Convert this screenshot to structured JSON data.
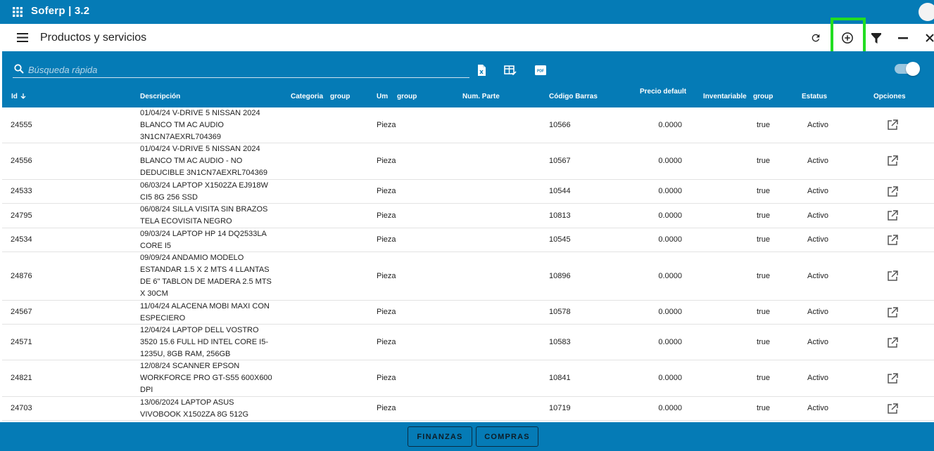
{
  "app": {
    "title": "Soferp | 3.2"
  },
  "header": {
    "title": "Productos y servicios"
  },
  "search": {
    "placeholder": "Búsqueda rápida",
    "value": ""
  },
  "columns": {
    "id": "Id",
    "descripcion": "Descripción",
    "categoria": "Categoria",
    "categoria_group": "group",
    "um": "Um",
    "um_group": "group",
    "num_parte": "Num. Parte",
    "codigo_barras": "Código Barras",
    "precio_default": "Precio default",
    "inventariable": "Inventariable",
    "inventariable_group": "group",
    "estatus": "Estatus",
    "opciones": "Opciones"
  },
  "rows": [
    {
      "id": "24555",
      "desc": [
        "01/04/24 V-DRIVE 5 NISSAN 2024",
        "BLANCO TM AC AUDIO",
        "3N1CN7AEXRL704369"
      ],
      "um": "Pieza",
      "codigo": "10566",
      "precio": "0.0000",
      "inventariable": "true",
      "estatus": "Activo"
    },
    {
      "id": "24556",
      "desc": [
        "01/04/24 V-DRIVE 5 NISSAN 2024",
        "BLANCO TM AC AUDIO - NO",
        "DEDUCIBLE 3N1CN7AEXRL704369"
      ],
      "um": "Pieza",
      "codigo": "10567",
      "precio": "0.0000",
      "inventariable": "true",
      "estatus": "Activo"
    },
    {
      "id": "24533",
      "desc": [
        "06/03/24 LAPTOP X1502ZA EJ918W",
        "CI5 8G 256 SSD"
      ],
      "um": "Pieza",
      "codigo": "10544",
      "precio": "0.0000",
      "inventariable": "true",
      "estatus": "Activo"
    },
    {
      "id": "24795",
      "desc": [
        "06/08/24 SILLA VISITA SIN BRAZOS",
        "TELA ECOVISITA NEGRO"
      ],
      "um": "Pieza",
      "codigo": "10813",
      "precio": "0.0000",
      "inventariable": "true",
      "estatus": "Activo"
    },
    {
      "id": "24534",
      "desc": [
        "09/03/24 LAPTOP HP 14 DQ2533LA",
        "CORE I5"
      ],
      "um": "Pieza",
      "codigo": "10545",
      "precio": "0.0000",
      "inventariable": "true",
      "estatus": "Activo"
    },
    {
      "id": "24876",
      "desc": [
        "09/09/24 ANDAMIO MODELO",
        "ESTANDAR 1.5 X 2 MTS 4 LLANTAS",
        "DE 6\" TABLON DE MADERA 2.5 MTS",
        "X 30CM"
      ],
      "um": "Pieza",
      "codigo": "10896",
      "precio": "0.0000",
      "inventariable": "true",
      "estatus": "Activo"
    },
    {
      "id": "24567",
      "desc": [
        "11/04/24 ALACENA MOBI MAXI CON",
        "ESPECIERO"
      ],
      "um": "Pieza",
      "codigo": "10578",
      "precio": "0.0000",
      "inventariable": "true",
      "estatus": "Activo"
    },
    {
      "id": "24571",
      "desc": [
        "12/04/24 LAPTOP DELL VOSTRO",
        "3520 15.6 FULL HD INTEL CORE I5-",
        "1235U, 8GB RAM, 256GB"
      ],
      "um": "Pieza",
      "codigo": "10583",
      "precio": "0.0000",
      "inventariable": "true",
      "estatus": "Activo"
    },
    {
      "id": "24821",
      "desc": [
        "12/08/24 SCANNER EPSON",
        "WORKFORCE PRO GT-S55 600X600",
        "DPI"
      ],
      "um": "Pieza",
      "codigo": "10841",
      "precio": "0.0000",
      "inventariable": "true",
      "estatus": "Activo"
    },
    {
      "id": "24703",
      "desc": [
        "13/06/2024 LAPTOP ASUS",
        "VIVOBOOK X1502ZA 8G 512G"
      ],
      "um": "Pieza",
      "codigo": "10719",
      "precio": "0.0000",
      "inventariable": "true",
      "estatus": "Activo"
    }
  ],
  "footer": {
    "finanzas": "FINANZAS",
    "compras": "COMPRAS"
  },
  "colors": {
    "primary": "#057bb6",
    "highlight": "#22dd22"
  },
  "icons": [
    "apps-grid-icon",
    "menu-icon",
    "refresh-icon",
    "add-circle-icon",
    "filter-icon",
    "minimize-icon",
    "close-icon",
    "search-icon",
    "excel-icon",
    "table-check-icon",
    "pdf-icon",
    "open-in-new-icon",
    "sort-arrow-down-icon"
  ]
}
